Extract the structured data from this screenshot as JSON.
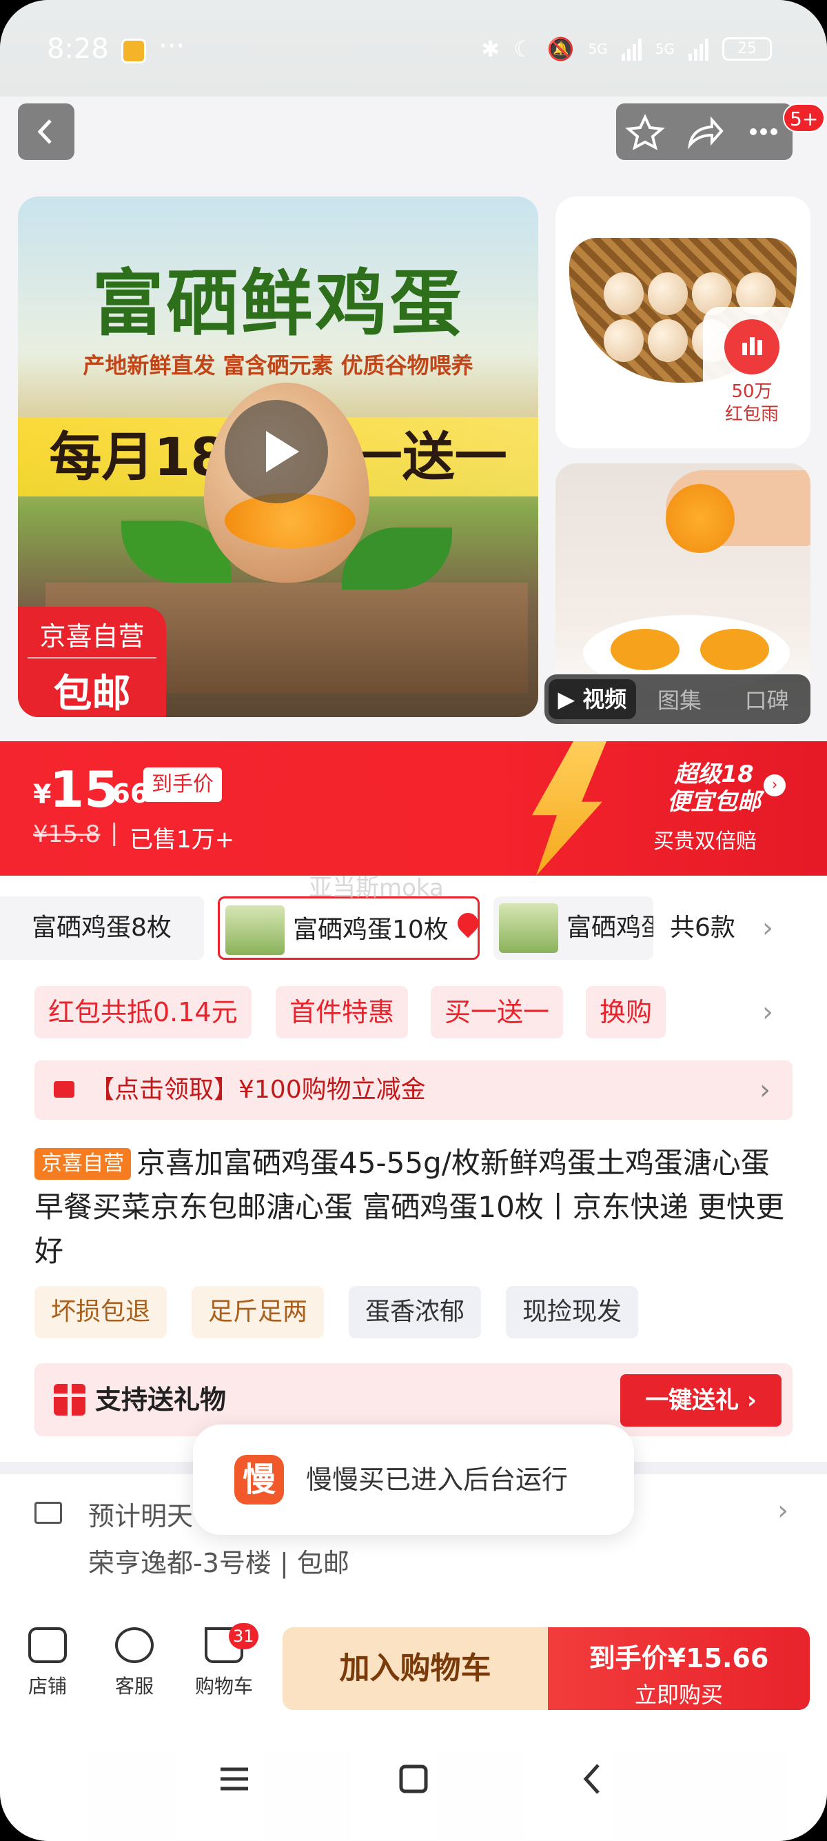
{
  "status_bar": {
    "time": "8:28",
    "more": "···",
    "network1": "5G",
    "network2": "5G",
    "battery": "25"
  },
  "topnav": {
    "cart_badge_count": "5+"
  },
  "media": {
    "headline": "富硒鲜鸡蛋",
    "subline": "产地新鲜直发   富含硒元素   优质谷物喂养",
    "promo": "每月18日 买一送一",
    "tag_top": "京喜自营",
    "tag_bottom": "包邮",
    "red_rain_amount": "50万",
    "red_rain_label": "红包雨",
    "tabs": [
      "视频",
      "图集",
      "口碑"
    ]
  },
  "price": {
    "symbol": "¥",
    "integer": "15",
    "decimal": ".66",
    "tag": "到手价",
    "original": "¥15.8",
    "separator": "|",
    "sold": "已售1万+",
    "super_line1": "超级18",
    "super_line2": "便宜包邮",
    "guarantee": "买贵双倍赔"
  },
  "variants": {
    "items": [
      {
        "label": "富硒鸡蛋8枚"
      },
      {
        "label": "富硒鸡蛋10枚"
      },
      {
        "label": "富硒鸡蛋"
      }
    ],
    "total": "共6款",
    "watermark": "亚当斯moka"
  },
  "promos": [
    "红包共抵0.14元",
    "首件特惠",
    "买一送一",
    "换购"
  ],
  "coupon": {
    "text": "【点击领取】¥100购物立减金"
  },
  "product": {
    "badge": "京喜自营",
    "title": "京喜加富硒鸡蛋45-55g/枚新鲜鸡蛋土鸡蛋溏心蛋早餐买菜京东包邮溏心蛋 富硒鸡蛋10枚丨京东快递 更快更好"
  },
  "features": [
    "坏损包退",
    "足斤足两",
    "蛋香浓郁",
    "现捡现发"
  ],
  "gift": {
    "text": "支持送礼物",
    "button": "一键送礼 ›"
  },
  "delivery": {
    "line1": "预计明天",
    "line2": "荣亨逸都-3号楼 | 包邮"
  },
  "toast": {
    "icon": "慢",
    "text": "慢慢买已进入后台运行"
  },
  "bottom_bar": {
    "shop": "店铺",
    "service": "客服",
    "cart": "购物车",
    "cart_count": "31",
    "add_to_cart": "加入购物车",
    "buy_line1": "到手价¥15.66",
    "buy_line2": "立即购买"
  },
  "colors": {
    "accent": "#e8232b",
    "cart_button": "#fbe2c3",
    "bolt": "#f6a81d"
  }
}
